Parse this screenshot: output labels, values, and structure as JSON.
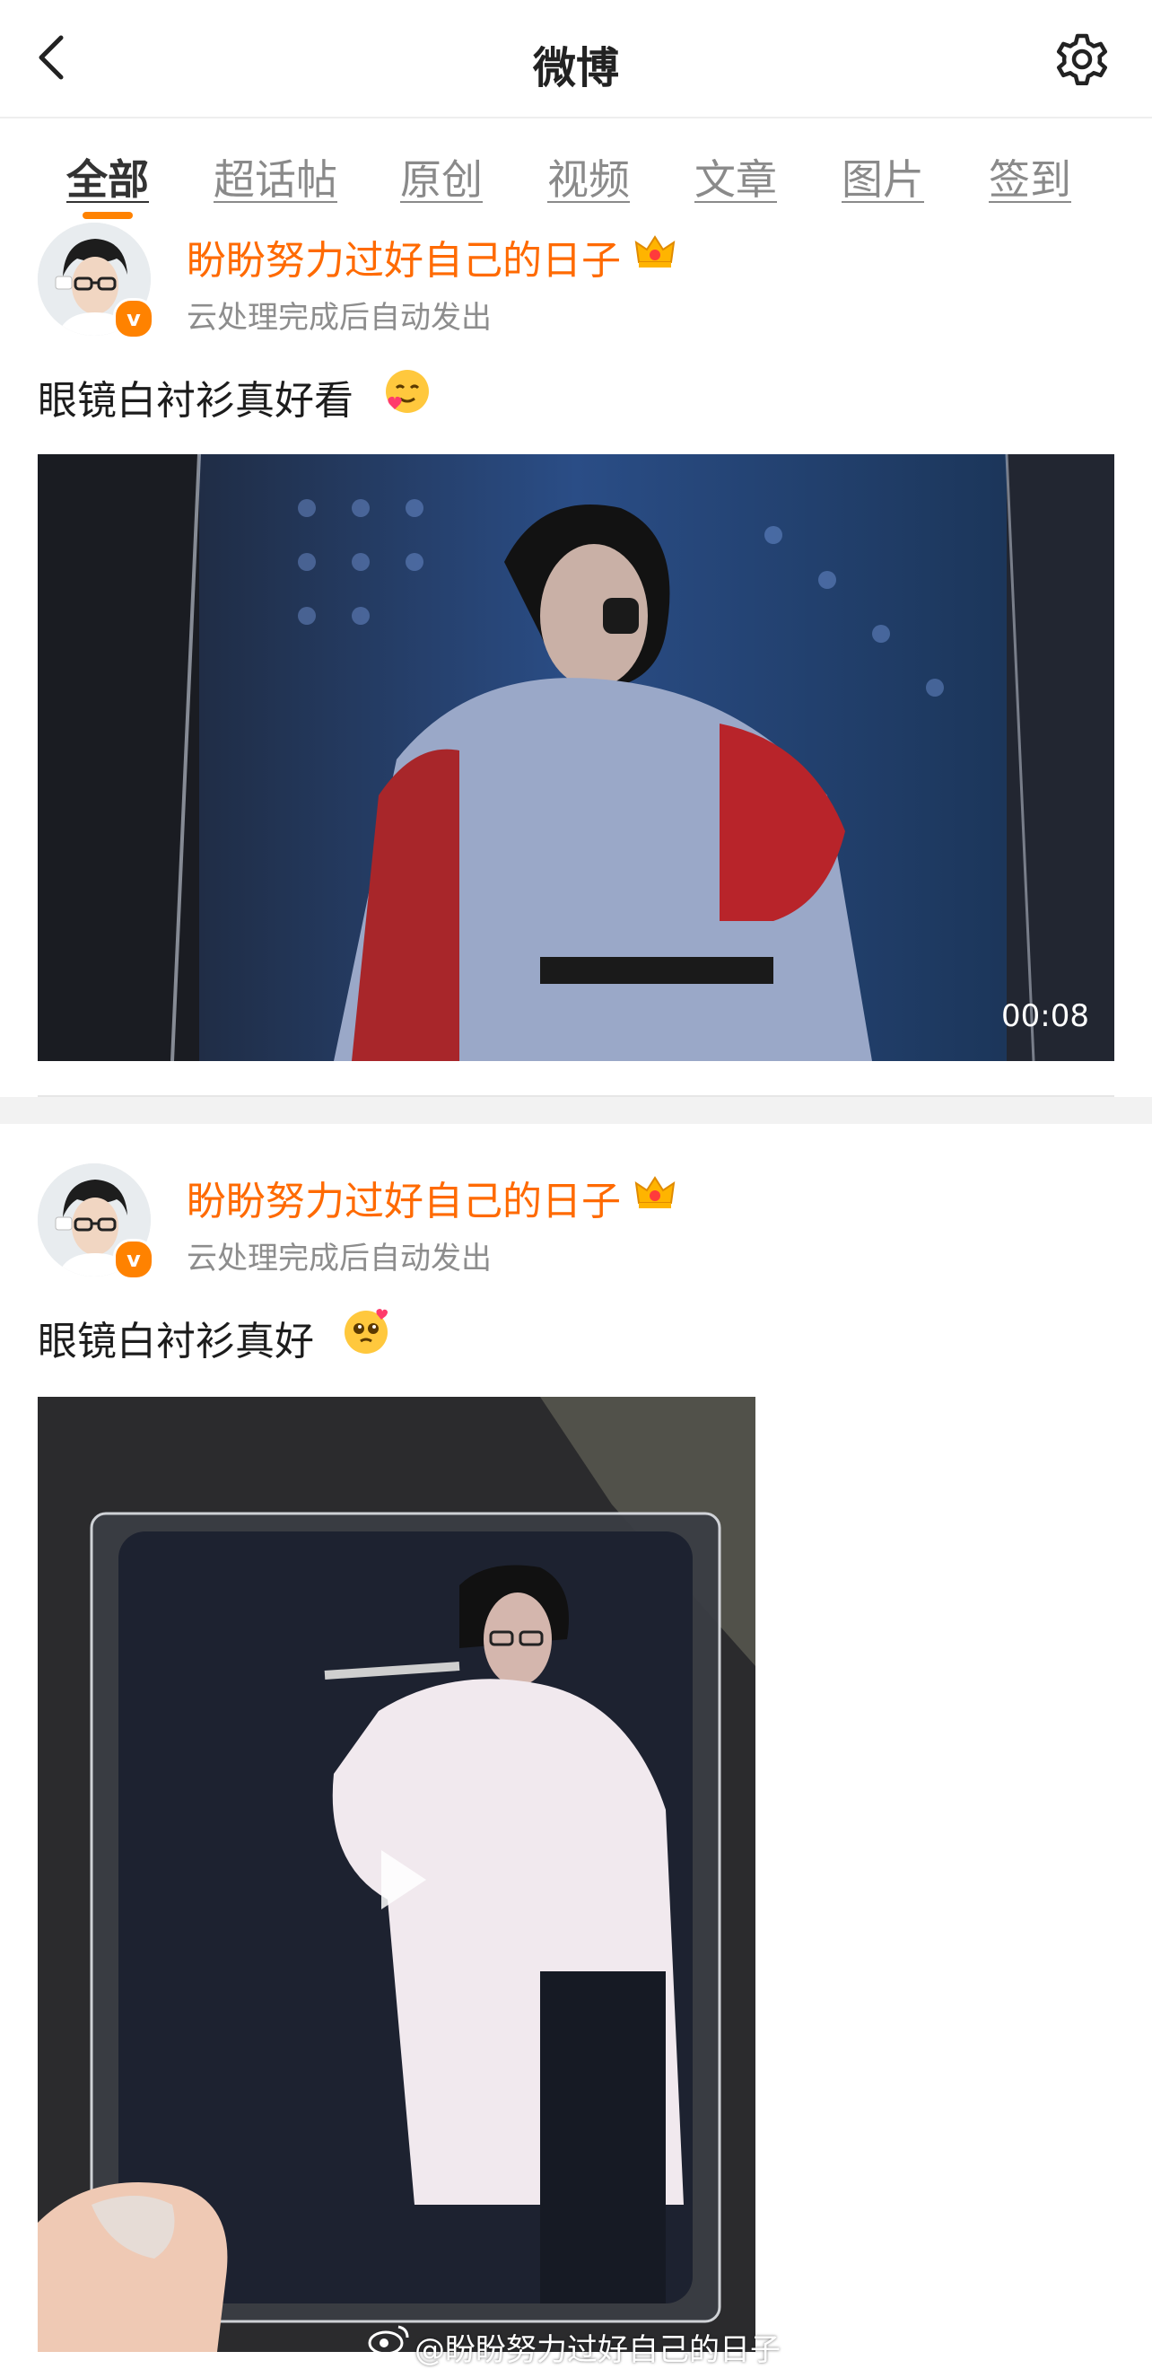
{
  "header": {
    "title": "微博",
    "back_icon": "chevron-left-icon",
    "settings_icon": "gear-icon"
  },
  "tabs": [
    {
      "label": "全部",
      "active": true
    },
    {
      "label": "超话帖",
      "active": false
    },
    {
      "label": "原创",
      "active": false
    },
    {
      "label": "视频",
      "active": false
    },
    {
      "label": "文章",
      "active": false
    },
    {
      "label": "图片",
      "active": false
    },
    {
      "label": "签到",
      "active": false
    }
  ],
  "posts": [
    {
      "username": "盼盼努力过好自己的日子",
      "badge": "v",
      "meta": "云处理完成后自动发出",
      "text": "眼镜白衬衫真好看",
      "emoji": "smiling-face-with-hearts-icon",
      "video_duration": "00:08"
    },
    {
      "username": "盼盼努力过好自己的日子",
      "badge": "v",
      "meta": "云处理完成后自动发出",
      "text": "眼镜白衬衫真好",
      "emoji": "pleading-face-with-hearts-icon",
      "watermark": "@盼盼努力过好自己的日子"
    }
  ],
  "colors": {
    "accent": "#ff8200",
    "username": "#ff6a00",
    "meta": "#8d8d8d"
  }
}
